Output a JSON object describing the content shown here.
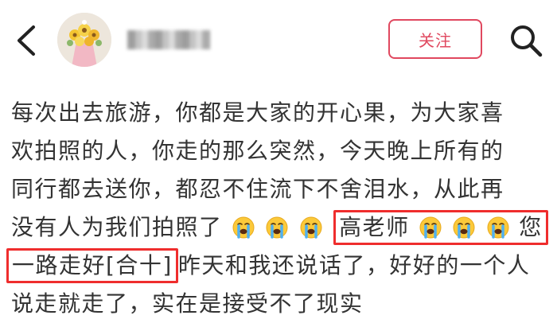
{
  "header": {
    "follow_label": "关注",
    "back_icon": "chevron-left-icon",
    "search_icon": "search-icon",
    "accent_color": "#e0485f"
  },
  "post": {
    "line1": "每次出去旅游，你都是大家的开心果，为大家喜",
    "line2": "欢拍照的人，你走的那么突然，今天晚上所有的",
    "line3": "同行都去送你，都忍不住流下不舍泪水，从此再",
    "line4_start": "没有人为我们拍照了",
    "line4_highlight_text": "高老师",
    "line4_end": "您",
    "line5_highlight_text": "一路走好[合十]",
    "line5_rest": "昨天和我还说话了，好好的一个人",
    "line6": "说走就走了，实在是接受不了现实",
    "emoji_name": "loudly-crying-face-icon",
    "highlight_color": "#ef2d2d"
  }
}
